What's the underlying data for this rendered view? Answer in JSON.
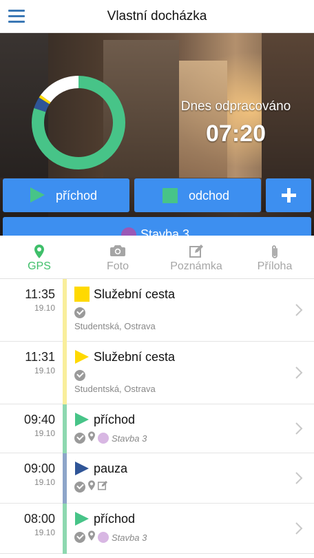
{
  "header": {
    "title": "Vlastní docházka",
    "menu_icon": "hamburger-icon"
  },
  "hero": {
    "label": "Dnes odpracováno",
    "time": "07:20",
    "ring": {
      "colors": {
        "green": "#47c488",
        "blue": "#2f5597",
        "yellow": "#ffd900",
        "white": "#ffffff"
      },
      "segments": [
        {
          "color": "green",
          "fraction": 0.8
        },
        {
          "color": "blue",
          "fraction": 0.04
        },
        {
          "color": "yellow",
          "fraction": 0.01
        },
        {
          "color": "white",
          "fraction": 0.15
        }
      ]
    }
  },
  "buttons": {
    "arrive": "příchod",
    "leave": "odchod",
    "site": "Stavba 3",
    "accent": "#3d8ff0"
  },
  "tabs": [
    {
      "label": "GPS",
      "icon": "location-pin-icon",
      "active": true
    },
    {
      "label": "Foto",
      "icon": "camera-icon",
      "active": false
    },
    {
      "label": "Poznámka",
      "icon": "edit-icon",
      "active": false
    },
    {
      "label": "Příloha",
      "icon": "paperclip-icon",
      "active": false
    }
  ],
  "entries": [
    {
      "time": "11:35",
      "date": "19.10",
      "label": "Služební cesta",
      "address": "Studentská, Ostrava",
      "icon": "yellow-square-icon",
      "bar": "#f9ee9b"
    },
    {
      "time": "11:31",
      "date": "19.10",
      "label": "Služební cesta",
      "address": "Studentská, Ostrava",
      "icon": "yellow-play-icon",
      "bar": "#f9ee9b"
    },
    {
      "time": "09:40",
      "date": "19.10",
      "label": "příchod",
      "site": "Stavba 3",
      "icon": "green-play-icon",
      "bar": "#8ed8b0"
    },
    {
      "time": "09:00",
      "date": "19.10",
      "label": "pauza",
      "icon": "blue-play-icon",
      "bar": "#8ea5c9"
    },
    {
      "time": "08:00",
      "date": "19.10",
      "label": "příchod",
      "site": "Stavba 3",
      "icon": "green-play-icon",
      "bar": "#8ed8b0"
    }
  ]
}
